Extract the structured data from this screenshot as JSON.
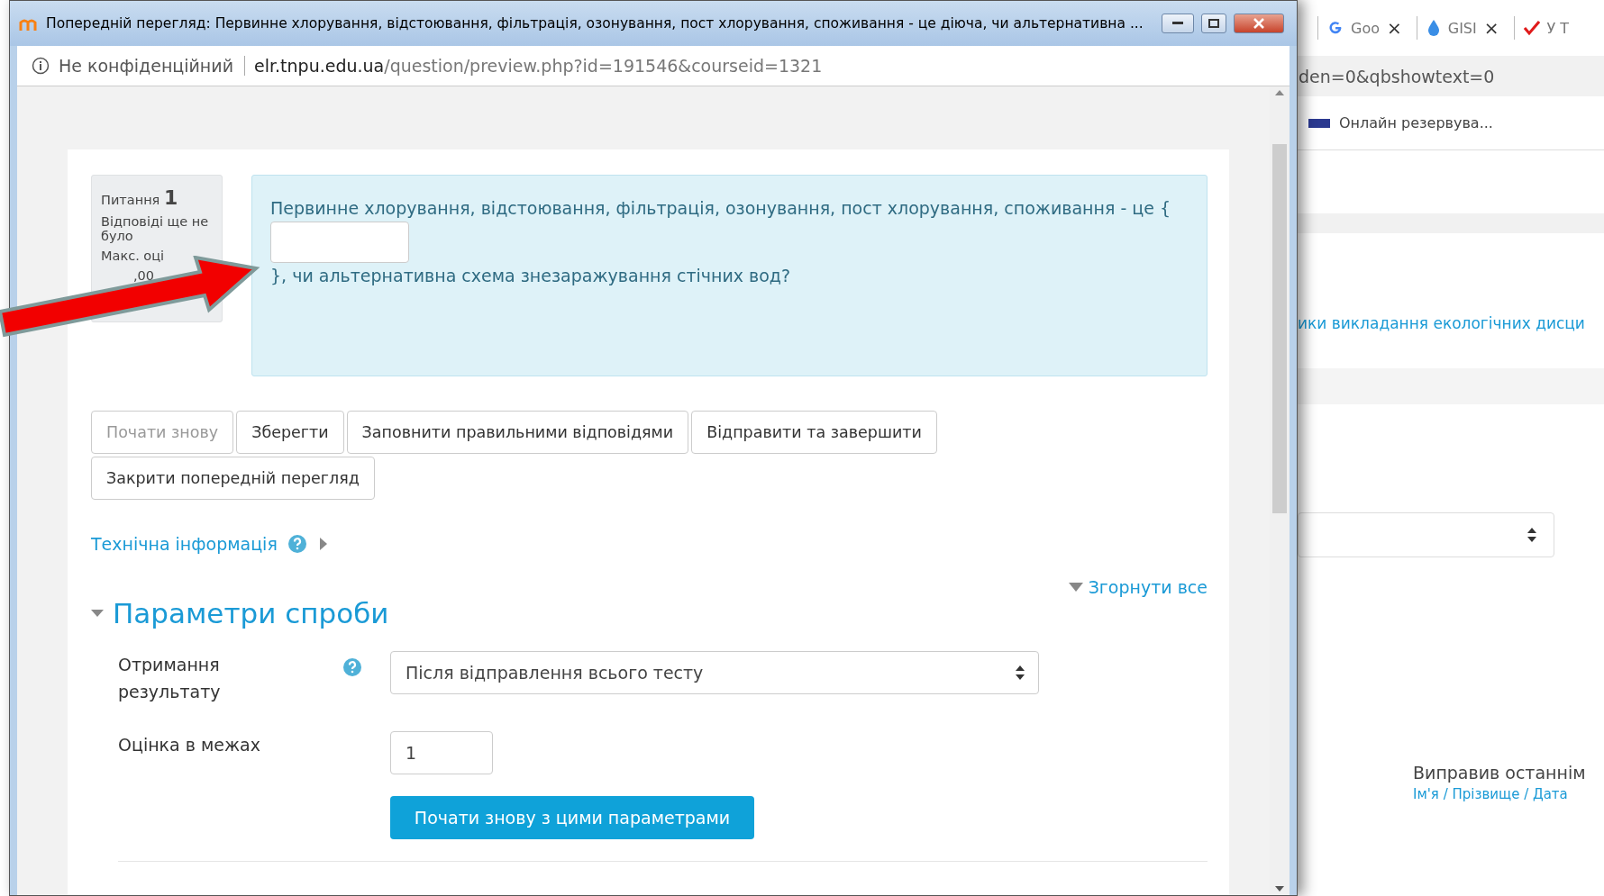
{
  "back_browser": {
    "tabs": [
      {
        "label": "Goo",
        "kind": "google",
        "close": "×"
      },
      {
        "label": "GISI",
        "kind": "drop",
        "close": "×"
      },
      {
        "label": "У Т",
        "kind": "check"
      }
    ],
    "url": "den=0&qbshowtext=0",
    "bookmark": "Онлайн резервува...",
    "link": "ики викладання екологічних дисци",
    "footer_label": "Виправив останнім",
    "footer_link": "Ім'я / Прізвище / Дата"
  },
  "popup": {
    "title": "Попередній перегляд: Первинне хлорування, відстоювання, фільтрація, озонування, пост хлорування, споживання - це діюча, чи альтернативна ...",
    "security": "Не конфіденційний",
    "url_host": "elr.tnpu.edu.ua",
    "url_path": "/question/preview.php?id=191546&courseid=1321",
    "info": {
      "label": "Питання",
      "number": "1",
      "status": "Відповіді ще не було",
      "mark": "Макс. оці",
      "mark_value": ",00"
    },
    "question": {
      "before": "Первинне хлорування, відстоювання, фільтрація, озонування, пост хлорування, споживання - це {",
      "after": "}, чи альтернативна схема знезаражування стічних вод?"
    },
    "buttons": [
      {
        "label": "Почати знову",
        "disabled": true
      },
      {
        "label": "Зберегти",
        "disabled": false
      },
      {
        "label": "Заповнити правильними відповідями",
        "disabled": false
      },
      {
        "label": "Відправити та завершити",
        "disabled": false
      },
      {
        "label": "Закрити попередній перегляд",
        "disabled": false
      }
    ],
    "tech_info": {
      "label": "Технічна інформація",
      "expanded": false
    },
    "collapse_all": "Згорнути все",
    "section": {
      "title": "Параметри спроби",
      "expanded": true,
      "fields": [
        {
          "kind": "select",
          "label": "Отримання результату",
          "help": true,
          "value": "Після відправлення всього тесту"
        },
        {
          "kind": "text",
          "label": "Оцінка в межах",
          "help": false,
          "value": "1"
        }
      ],
      "submit": "Почати знову з цими параметрами"
    }
  }
}
